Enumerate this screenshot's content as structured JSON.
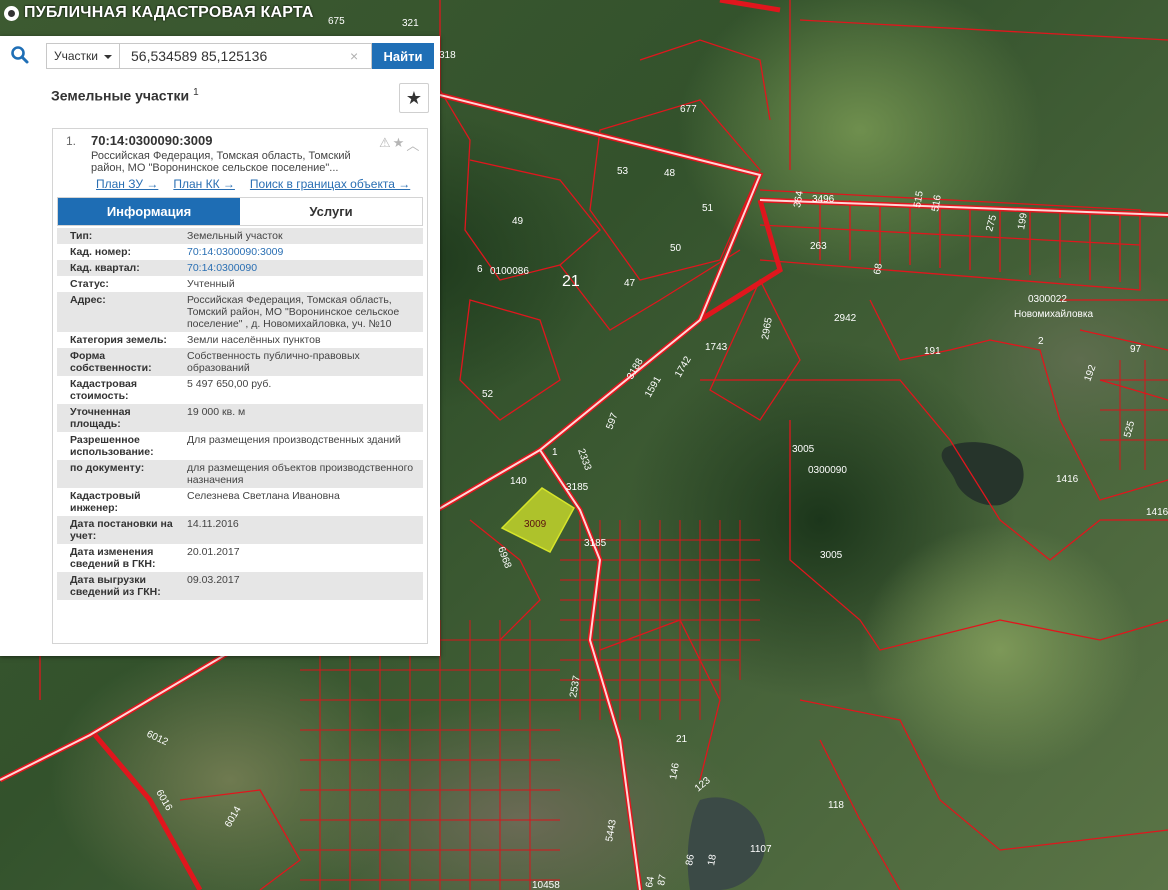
{
  "app": {
    "title": "ПУБЛИЧНАЯ КАДАСТРОВАЯ КАРТА"
  },
  "search": {
    "type_label": "Участки",
    "query": "56,534589 85,125136",
    "clear_glyph": "×",
    "find_label": "Найти"
  },
  "results": {
    "title": "Земельные участки",
    "count": "1",
    "favorite_glyph": "★"
  },
  "card": {
    "index": "1.",
    "number": "70:14:0300090:3009",
    "address": "Российская Федерация, Томская область, Томский район, МО \"Воронинское сельское поселение\"...",
    "warn_glyph": "⚠",
    "star_glyph": "★",
    "collapse_glyph": "︿",
    "links": [
      "План ЗУ →",
      "План КК →",
      "Поиск в границах объекта →"
    ],
    "tabs": [
      "Информация",
      "Услуги"
    ]
  },
  "info": [
    {
      "key": "Тип:",
      "value": "Земельный участок"
    },
    {
      "key": "Кад. номер:",
      "value": "70:14:0300090:3009",
      "link": true
    },
    {
      "key": "Кад. квартал:",
      "value": "70:14:0300090",
      "link": true
    },
    {
      "key": "Статус:",
      "value": "Учтенный"
    },
    {
      "key": "Адрес:",
      "value": "Российская Федерация, Томская область, Томский район, МО \"Воронинское сельское поселение\" , д. Новомихайловка, уч. №10"
    },
    {
      "key": "Категория земель:",
      "value": "Земли населённых пунктов"
    },
    {
      "key": "Форма собственности:",
      "value": "Собственность публично-правовых образований"
    },
    {
      "key": "Кадастровая стоимость:",
      "value": "5 497 650,00 руб."
    },
    {
      "key": "Уточненная площадь:",
      "value": "19 000 кв. м"
    },
    {
      "key": "Разрешенное использование:",
      "value": "Для размещения производственных зданий"
    },
    {
      "key": "по документу:",
      "value": "для размещения объектов производственного назначения"
    },
    {
      "key": "Кадастровый инженер:",
      "value": "Селезнева Светлана Ивановна"
    },
    {
      "key": "Дата постановки на учет:",
      "value": "14.11.2016"
    },
    {
      "key": "Дата изменения сведений в ГКН:",
      "value": "20.01.2017"
    },
    {
      "key": "Дата выгрузки сведений из ГКН:",
      "value": "09.03.2017"
    }
  ],
  "map_labels": {
    "l675": "675",
    "l321": "321",
    "l318": "318",
    "l677": "677",
    "l53": "53",
    "l48": "48",
    "l51": "51",
    "l49": "49",
    "l50": "50",
    "l6": "6",
    "q0100086": "0100086",
    "l21": "21",
    "l47": "47",
    "l52": "52",
    "l3496": "3496",
    "l364": "364",
    "l515": "515",
    "l516": "516",
    "l275": "275",
    "l199": "199",
    "l263": "263",
    "l68": "68",
    "q0300022": "0300022",
    "village": "Новомихайловка",
    "l2942": "2942",
    "l1743": "1743",
    "l2965": "2965",
    "l191": "191",
    "l97": "97",
    "l192": "192",
    "l3188": "3188",
    "l1742": "1742",
    "l1591": "1591",
    "l597": "597",
    "l2333": "2333",
    "l1": "1",
    "l3005a": "3005",
    "q0300090": "0300090",
    "l1416a": "1416",
    "l1416b": "1416",
    "l525": "525",
    "l140": "140",
    "l3185a": "3185",
    "parcel": "3009",
    "l3185b": "3185",
    "l6968": "6968",
    "l3005b": "3005",
    "l2537": "2537",
    "l6012": "6012",
    "l6016": "6016",
    "l6014": "6014",
    "l21b": "21",
    "l146": "146",
    "l123": "123",
    "l118": "118",
    "l1107": "1107",
    "l5443": "5443",
    "l86": "86",
    "l18": "18",
    "l10458": "10458",
    "l87": "87",
    "l64": "64",
    "l2": "2",
    "l48b": "48",
    "l2b": "2"
  },
  "colors": {
    "accent": "#1e6db4",
    "boundary": "#e0161d",
    "parcel_fill": "#d6e52a"
  }
}
